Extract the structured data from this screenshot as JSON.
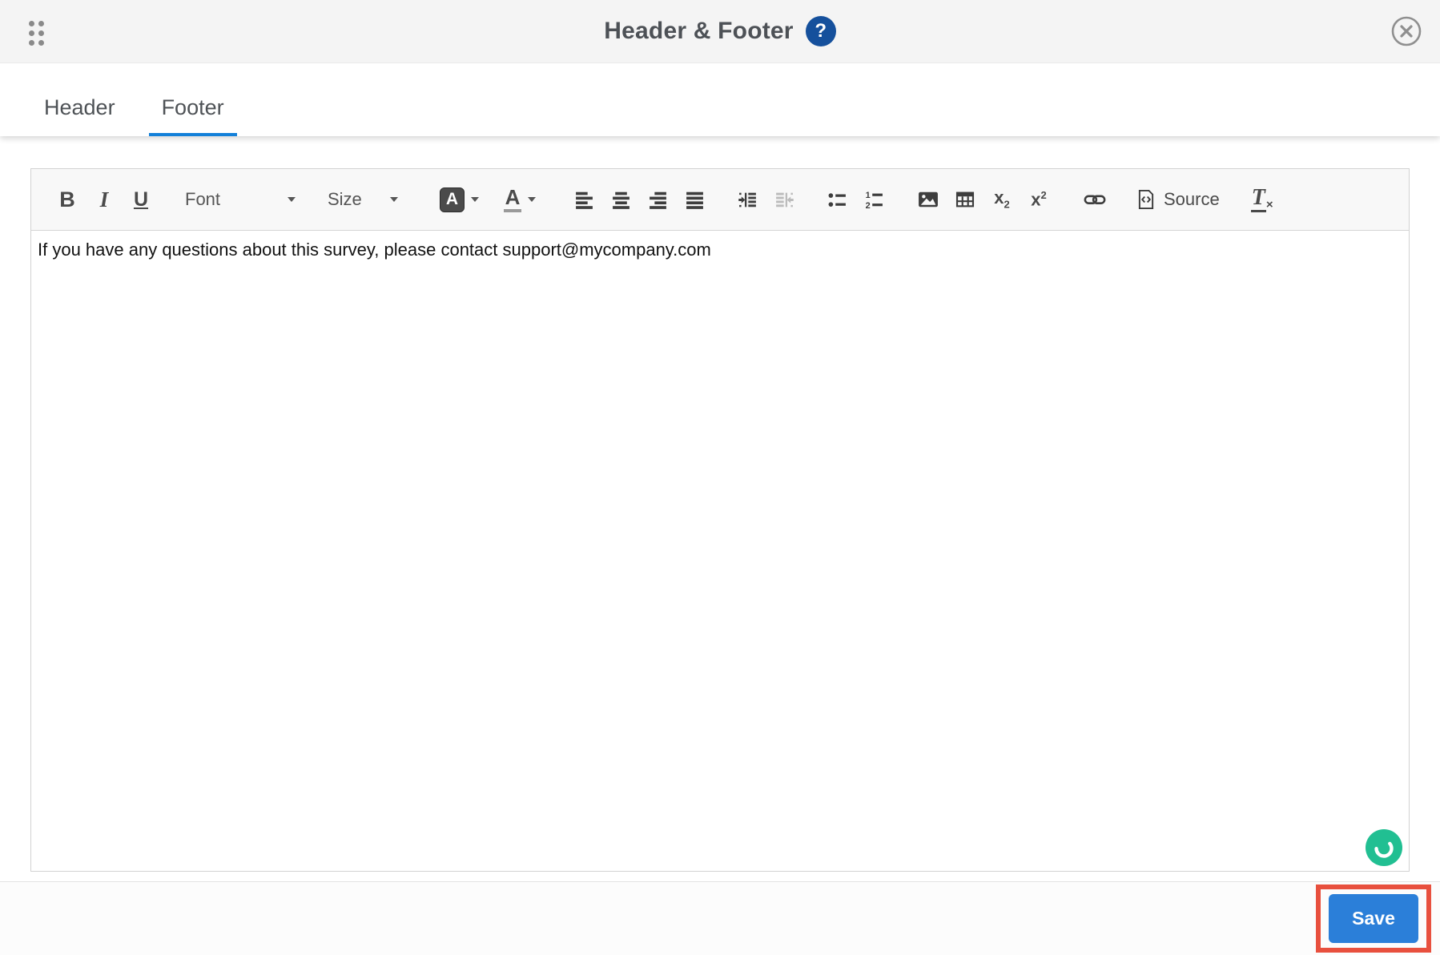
{
  "dialog": {
    "title": "Header & Footer",
    "help_glyph": "?"
  },
  "tabs": [
    {
      "label": "Header",
      "active": false
    },
    {
      "label": "Footer",
      "active": true
    }
  ],
  "toolbar": {
    "bold_glyph": "B",
    "italic_glyph": "I",
    "underline_glyph": "U",
    "font_label": "Font",
    "size_label": "Size",
    "auto_color_glyph": "A",
    "text_color_glyph": "A",
    "subscript_base": "x",
    "subscript_small": "2",
    "superscript_base": "x",
    "superscript_small": "2",
    "numbered_list_digit_1": "1",
    "numbered_list_digit_2": "2",
    "source_label": "Source",
    "remove_format_base": "T",
    "remove_format_small": "×",
    "disabled_buttons": [
      "outdent"
    ]
  },
  "editor": {
    "content": "If you have any questions about this survey, please contact support@mycompany.com"
  },
  "footer": {
    "save_label": "Save"
  },
  "colors": {
    "active_tab_blue": "#1380d9",
    "save_button_blue": "#2b7fd9",
    "help_icon_blue": "#15509c",
    "annotation_red": "#e8503e",
    "feedback_green": "#21bf92",
    "topbar_gray": "#f4f4f4",
    "toolbar_gray": "#f8f8f8",
    "icon_gray": "#4a4a4a"
  }
}
